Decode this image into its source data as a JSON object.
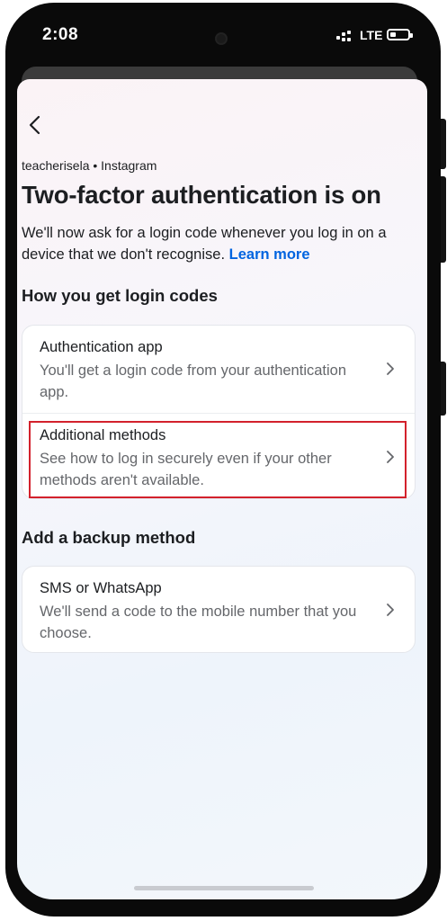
{
  "status_bar": {
    "time": "2:08",
    "network": "LTE",
    "icons": [
      "signal-icon",
      "battery-icon"
    ]
  },
  "header": {
    "back_icon": "chevron-left-icon",
    "account": "teacherisela • Instagram",
    "title": "Two-factor authentication is on",
    "description": "We'll now ask for a login code whenever you log in on a device that we don't recognise.",
    "learn_more": "Learn more"
  },
  "login_codes": {
    "heading": "How you get login codes",
    "items": [
      {
        "title": "Authentication app",
        "subtitle": "You'll get a login code from your authentication app.",
        "icon": "chevron-right-icon"
      },
      {
        "title": "Additional methods",
        "subtitle": "See how to log in securely even if your other methods aren't available.",
        "icon": "chevron-right-icon",
        "highlighted": true
      }
    ]
  },
  "backup": {
    "heading": "Add a backup method",
    "items": [
      {
        "title": "SMS or WhatsApp",
        "subtitle": "We'll send a code to the mobile number that you choose.",
        "icon": "chevron-right-icon"
      }
    ]
  },
  "colors": {
    "link": "#0064e0",
    "highlight": "#d3212c",
    "text_primary": "#1c1e21",
    "text_secondary": "#65676b"
  }
}
